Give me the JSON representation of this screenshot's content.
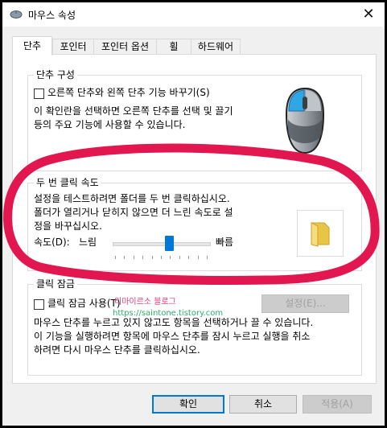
{
  "window": {
    "title": "마우스 속성",
    "close_glyph": "✕"
  },
  "tabs": [
    {
      "label": "단추",
      "active": true
    },
    {
      "label": "포인터",
      "active": false
    },
    {
      "label": "포인터 옵션",
      "active": false
    },
    {
      "label": "휠",
      "active": false
    },
    {
      "label": "하드웨어",
      "active": false
    }
  ],
  "button_config": {
    "title": "단추 구성",
    "switch_label": "오른쪽 단추와 왼쪽 단추 기능 바꾸기(S)",
    "switch_checked": false,
    "desc_line1": "이 확인란을 선택하면 오른쪽 단추를 선택 및 끌기",
    "desc_line2": "등의 주요 기능에 사용할 수 있습니다."
  },
  "double_click": {
    "title": "두 번 클릭 속도",
    "desc_line1": "설정을 테스트하려면 폴더를 두 번 클릭하십시오.",
    "desc_line2": "폴더가 열리거나 닫히지 않으면 더 느린 속도로 설",
    "desc_line3": "정을 바꾸십시오.",
    "speed_label": "속도(D):",
    "slow_label": "느림",
    "fast_label": "빠름",
    "speed_value": 0.58
  },
  "click_lock": {
    "title": "클릭 잠금",
    "checkbox_label": "클릭 잠금 사용(T)",
    "checked": false,
    "settings_button": "설정(E)...",
    "desc_line1": "마우스 단추를 누르고 있지 않고도 항목을 선택하거나 끌 수 있습니다.",
    "desc_line2": "이 기능을 실행하려면 항목에 마우스 단추를 잠시 누르고 실행을 취소",
    "desc_line3": "하려면 다시 마우스 단추를 클릭하십시오."
  },
  "watermark": {
    "line1": "티마이르소 블로그",
    "line2": "https://saintone.tistory.com"
  },
  "footer": {
    "ok": "확인",
    "cancel": "취소",
    "apply": "적용(A)"
  },
  "colors": {
    "accent": "#0078d7",
    "annotation_ring": "#e3174f"
  },
  "icons": {
    "mouse": "mouse-icon",
    "folder": "folder-icon",
    "window": "mouse-settings-icon",
    "close": "close-icon"
  }
}
